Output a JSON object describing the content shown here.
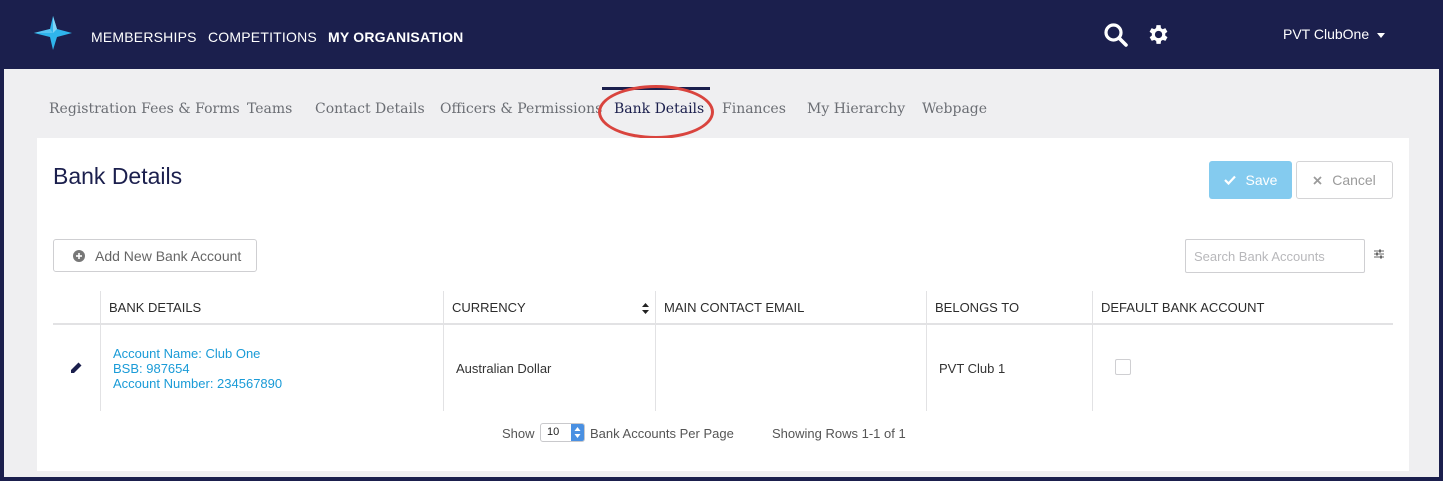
{
  "topnav": {
    "items": [
      {
        "label": "MEMBERSHIPS",
        "active": false
      },
      {
        "label": "COMPETITIONS",
        "active": false
      },
      {
        "label": "MY ORGANISATION",
        "active": true
      }
    ],
    "user": "PVT ClubOne",
    "icons": [
      "logo-star",
      "search-icon",
      "gear-icon",
      "chevron-down-icon"
    ]
  },
  "tabs": [
    {
      "label": "Registration Fees & Forms"
    },
    {
      "label": "Teams"
    },
    {
      "label": "Contact Details"
    },
    {
      "label": "Officers & Permissions"
    },
    {
      "label": "Bank Details",
      "active": true
    },
    {
      "label": "Finances"
    },
    {
      "label": "My Hierarchy"
    },
    {
      "label": "Webpage"
    }
  ],
  "card": {
    "title": "Bank Details",
    "save_label": "Save",
    "cancel_label": "Cancel",
    "add_label": "Add New Bank Account",
    "search_placeholder": "Search Bank Accounts"
  },
  "table": {
    "columns": [
      "BANK DETAILS",
      "CURRENCY",
      "MAIN CONTACT EMAIL",
      "BELONGS TO",
      "DEFAULT BANK ACCOUNT"
    ],
    "rows": [
      {
        "account_name": "Account Name: Club One",
        "bsb": "BSB: 987654",
        "account_number": "Account Number: 234567890",
        "currency": "Australian Dollar",
        "email": "",
        "belongs_to": "PVT Club 1",
        "default": false
      }
    ]
  },
  "pager": {
    "show_label": "Show",
    "per_page": "10",
    "per_page_label": "Bank Accounts Per Page",
    "summary": "Showing Rows 1-1 of 1"
  },
  "colors": {
    "navy": "#1b1f4d",
    "link_blue": "#1a9bd7",
    "save_blue": "#84cbef",
    "highlight_red": "#d9443e"
  }
}
